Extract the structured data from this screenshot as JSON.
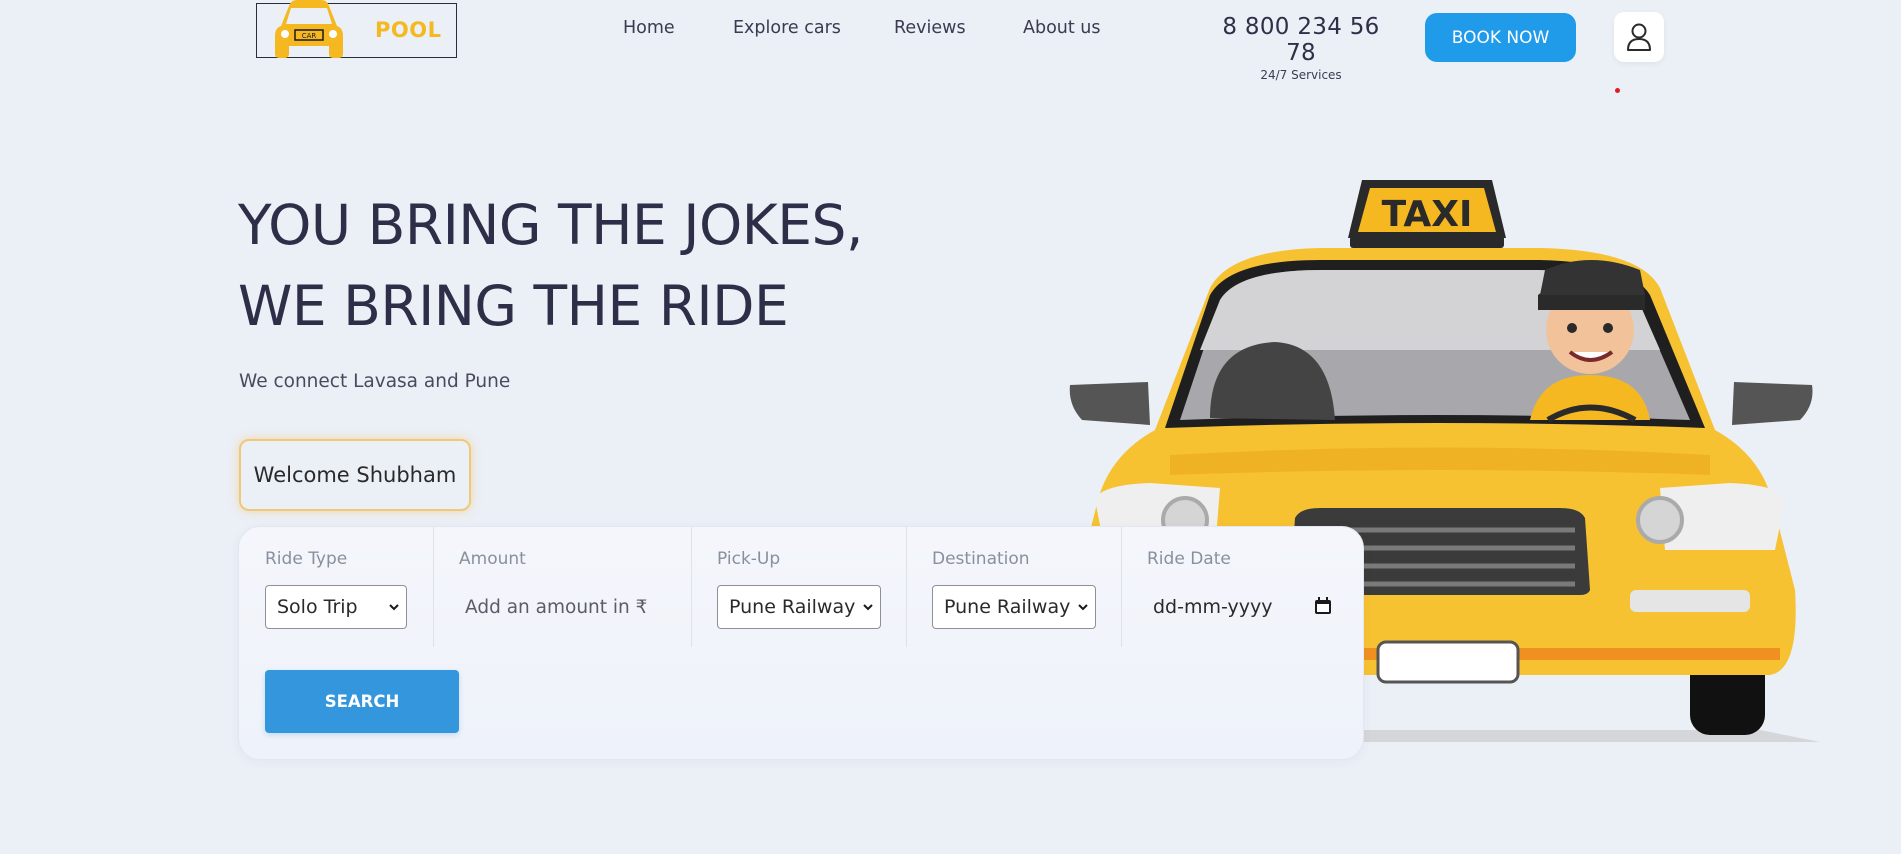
{
  "brand": {
    "logo_car_text": "CAR",
    "logo_text": "POOL",
    "accent_color": "#f5b820"
  },
  "nav": {
    "items": [
      {
        "label": "Home"
      },
      {
        "label": "Explore cars"
      },
      {
        "label": "Reviews"
      },
      {
        "label": "About us"
      }
    ]
  },
  "contact": {
    "phone": "8 800 234 56 78",
    "note": "24/7 Services"
  },
  "header": {
    "book_button": "BOOK NOW",
    "user_icon": "user-icon",
    "primary_color": "#1f9bea"
  },
  "hero": {
    "title_line1": "YOU BRING THE JOKES,",
    "title_line2": "WE BRING THE RIDE",
    "subtitle": "We connect Lavasa and Pune",
    "welcome": "Welcome Shubham",
    "taxi_sign": "TAXI"
  },
  "search": {
    "ride_type": {
      "label": "Ride Type",
      "value": "Solo Trip"
    },
    "amount": {
      "label": "Amount",
      "placeholder": "Add an amount in ₹"
    },
    "pickup": {
      "label": "Pick-Up",
      "value": "Pune Railway"
    },
    "destination": {
      "label": "Destination",
      "value": "Pune Railway"
    },
    "ride_date": {
      "label": "Ride Date",
      "placeholder": "dd-mm-yyyy"
    },
    "button": "SEARCH",
    "button_color": "#3497dd"
  }
}
